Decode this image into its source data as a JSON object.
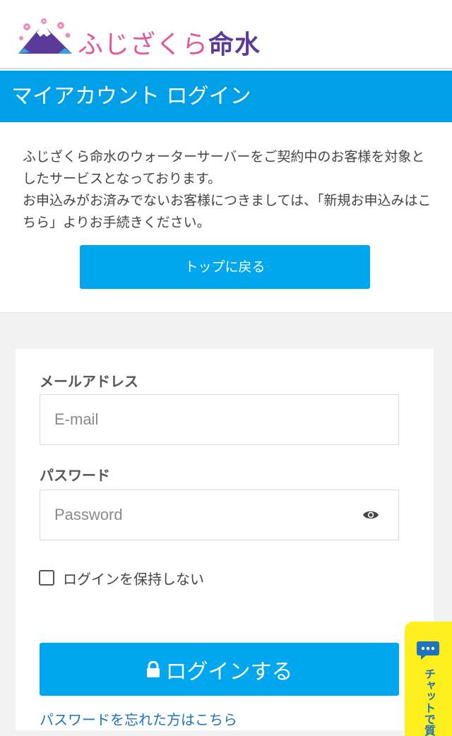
{
  "header": {
    "logo_text_kana": "ふじざくら",
    "logo_text_kanji": "命水",
    "logo_icon": "mountain-sakura-icon"
  },
  "title_bar": {
    "title": "マイアカウント ログイン"
  },
  "intro": {
    "paragraph_1": "ふじざくら命水のウォーターサーバーをご契約中のお客様を対象としたサービスとなっております。",
    "paragraph_2": "お申込みがお済みでないお客様につきましては、「新規お申込みはこちら」よりお手続きください。",
    "back_button_label": "トップに戻る"
  },
  "login_form": {
    "email_label": "メールアドレス",
    "email_placeholder": "E-mail",
    "email_value": "",
    "password_label": "パスワード",
    "password_placeholder": "Password",
    "password_value": "",
    "password_toggle_icon": "eye-icon",
    "remember_label": "ログインを保持しない",
    "remember_checked": false,
    "login_button_label": "ログインする",
    "login_button_icon": "lock-icon",
    "forgot_link_label": "パスワードを忘れた方はこちら"
  },
  "chat_tab": {
    "label": "チャットで質",
    "icon": "chat-bubble-icon"
  },
  "colors": {
    "accent": "#00a0e9",
    "button": "#00a7ef",
    "link": "#1e73be",
    "chat_tab": "#ffef1f",
    "logo_pink": "#e0579a",
    "logo_purple": "#5b3a99"
  }
}
